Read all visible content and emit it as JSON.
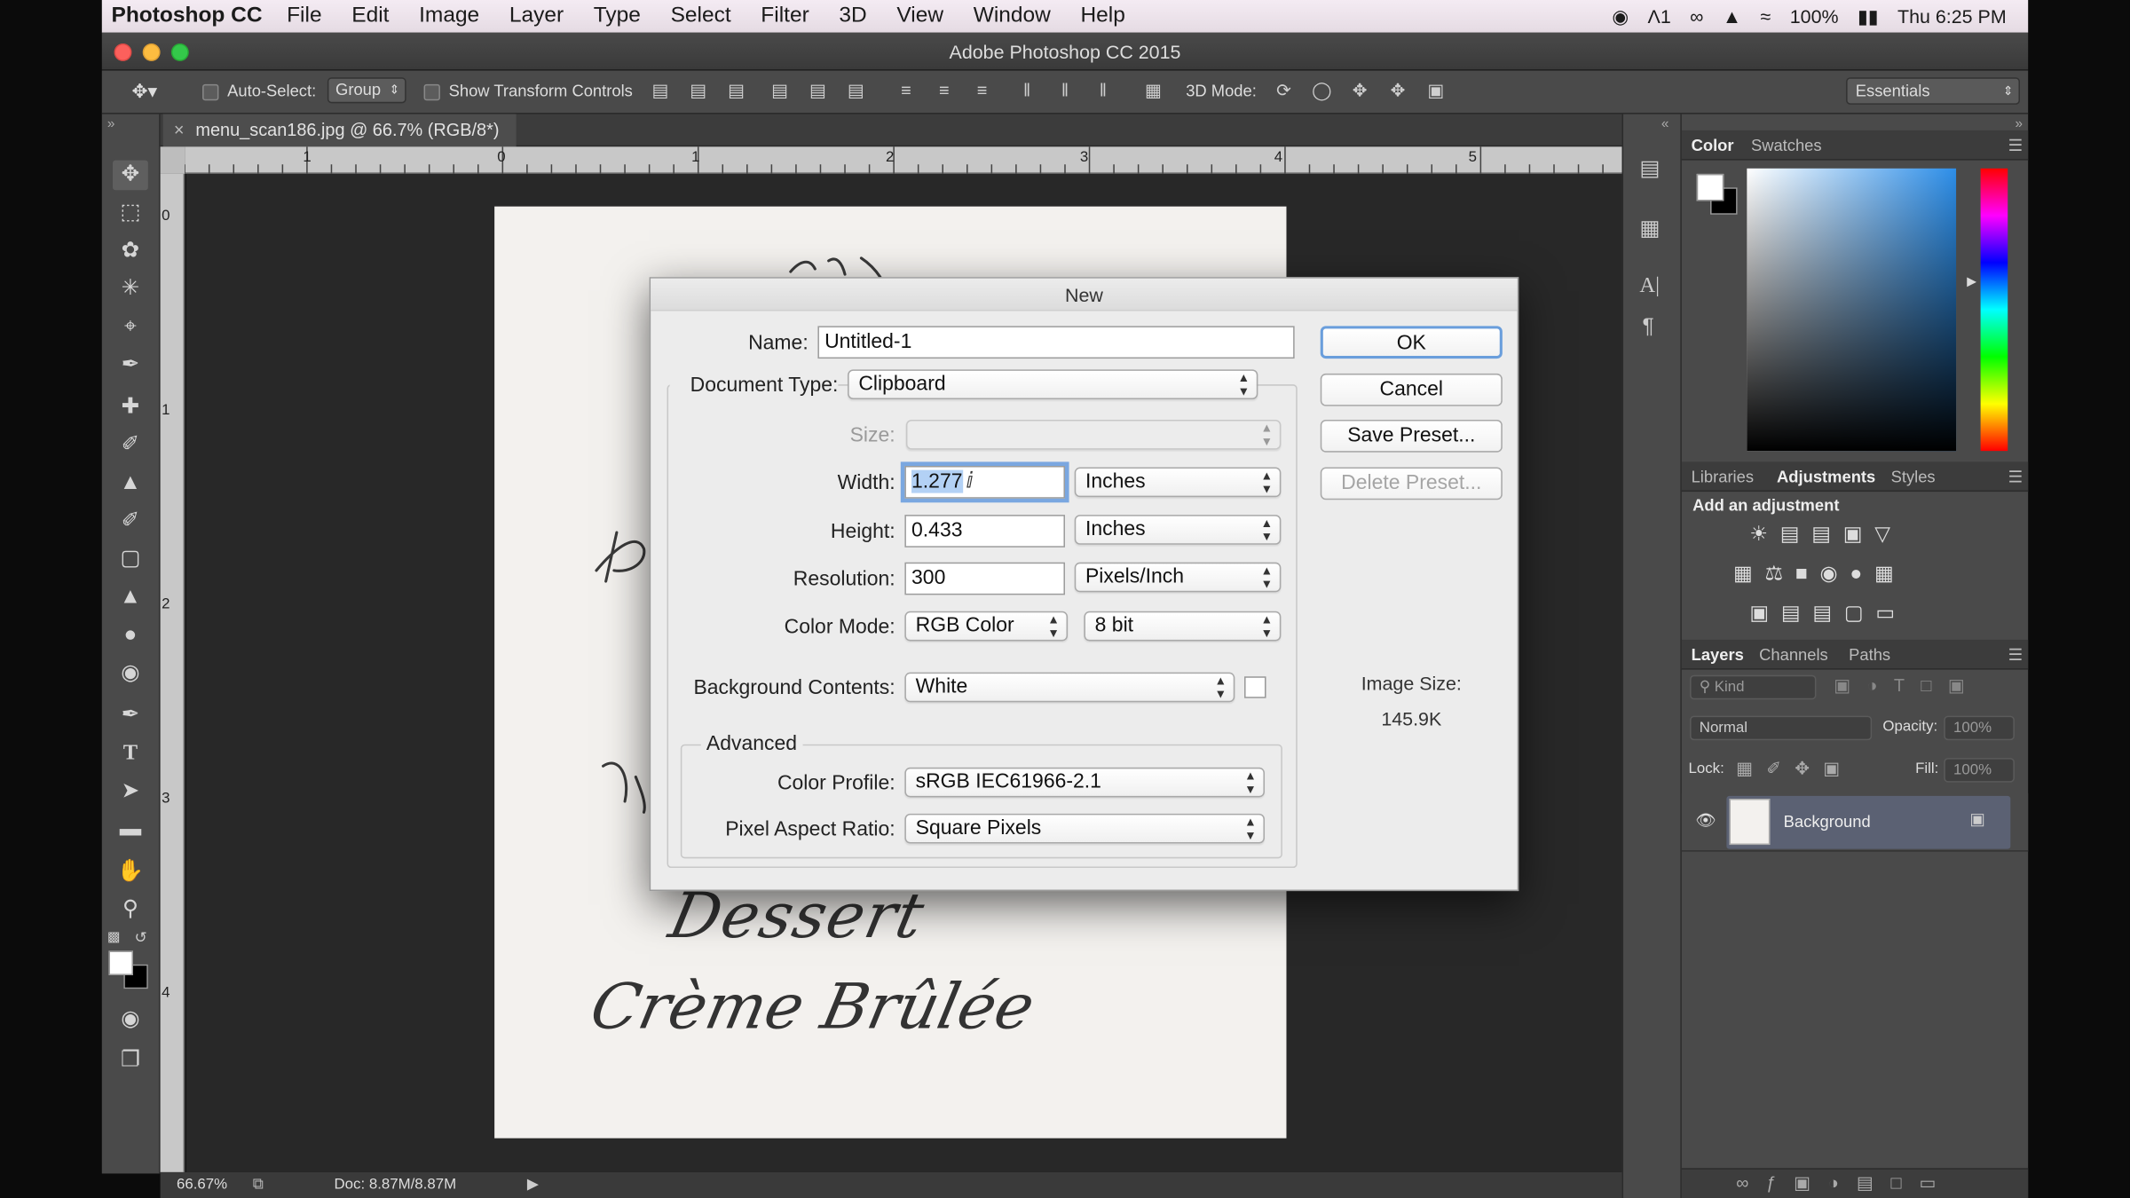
{
  "menubar": {
    "app": "Photoshop CC",
    "items": [
      "File",
      "Edit",
      "Image",
      "Layer",
      "Type",
      "Select",
      "Filter",
      "3D",
      "View",
      "Window",
      "Help"
    ],
    "battery": "100%",
    "clock": "Thu 6:25 PM",
    "adobe_status": "1"
  },
  "window": {
    "title": "Adobe Photoshop CC 2015"
  },
  "options_bar": {
    "auto_select_label": "Auto-Select:",
    "auto_select_value": "Group",
    "show_transform_label": "Show Transform Controls",
    "mode_3d_label": "3D Mode:",
    "workspace": "Essentials"
  },
  "document": {
    "tab_title": "menu_scan186.jpg @ 66.7% (RGB/8*)",
    "ruler_h": [
      "1",
      "0",
      "1",
      "2",
      "3",
      "4",
      "5"
    ],
    "ruler_v": [
      "0",
      "1",
      "2",
      "3",
      "4"
    ],
    "script_lines": [
      "Dessert",
      "Crème Brûlée"
    ]
  },
  "status": {
    "zoom": "66.67%",
    "doc": "Doc: 8.87M/8.87M"
  },
  "panels": {
    "color_tabs": [
      "Color",
      "Swatches"
    ],
    "adj_tabs": [
      "Libraries",
      "Adjustments",
      "Styles"
    ],
    "adj_heading": "Add an adjustment",
    "layers_tabs": [
      "Layers",
      "Channels",
      "Paths"
    ],
    "kind": "Kind",
    "blend_mode": "Normal",
    "opacity_label": "Opacity:",
    "opacity_value": "100%",
    "lock_label": "Lock:",
    "fill_label": "Fill:",
    "fill_value": "100%",
    "layer_name": "Background"
  },
  "dialog": {
    "title": "New",
    "name_label": "Name:",
    "name_value": "Untitled-1",
    "doc_type_label": "Document Type:",
    "doc_type_value": "Clipboard",
    "size_label": "Size:",
    "width_label": "Width:",
    "width_value": "1.277",
    "width_unit": "Inches",
    "height_label": "Height:",
    "height_value": "0.433",
    "height_unit": "Inches",
    "resolution_label": "Resolution:",
    "resolution_value": "300",
    "resolution_unit": "Pixels/Inch",
    "color_mode_label": "Color Mode:",
    "color_mode_value": "RGB Color",
    "bit_depth": "8 bit",
    "bg_label": "Background Contents:",
    "bg_value": "White",
    "advanced_label": "Advanced",
    "profile_label": "Color Profile:",
    "profile_value": "sRGB IEC61966-2.1",
    "par_label": "Pixel Aspect Ratio:",
    "par_value": "Square Pixels",
    "ok": "OK",
    "cancel": "Cancel",
    "save_preset": "Save Preset...",
    "delete_preset": "Delete Preset...",
    "image_size_label": "Image Size:",
    "image_size_value": "145.9K"
  }
}
